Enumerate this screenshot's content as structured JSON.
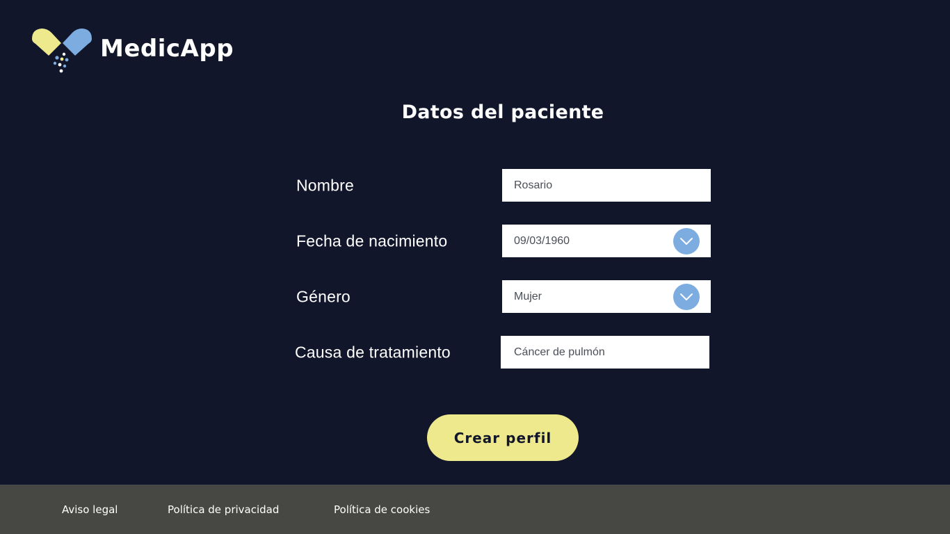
{
  "header": {
    "brand_name": "MedicApp",
    "logo_icon": "pill-capsule-icon",
    "brand_colors": {
      "yellow": "#efe98e",
      "blue": "#7cace0"
    }
  },
  "main": {
    "title": "Datos del paciente",
    "fields": [
      {
        "label": "Nombre",
        "value": "Rosario",
        "type": "text"
      },
      {
        "label": "Fecha de nacimiento",
        "value": "09/03/1960",
        "type": "date-select",
        "icon": "chevron-down-icon"
      },
      {
        "label": "Género",
        "value": "Mujer",
        "type": "select",
        "icon": "chevron-down-icon"
      },
      {
        "label": "Causa de tratamiento",
        "value": "Cáncer de pulmón",
        "type": "text"
      }
    ],
    "submit_label": "Crear perfil"
  },
  "footer": {
    "links": [
      "Aviso legal",
      "Política de privacidad",
      "Política de cookies"
    ]
  },
  "colors": {
    "background": "#11162a",
    "footer": "#474843",
    "button": "#efe98e",
    "accent": "#7cace0"
  }
}
